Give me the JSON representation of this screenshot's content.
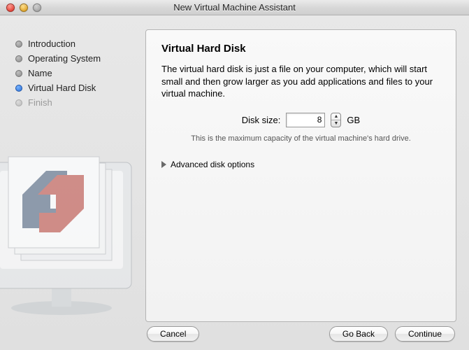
{
  "window": {
    "title": "New Virtual Machine Assistant"
  },
  "sidebar": {
    "steps": [
      {
        "label": "Introduction",
        "state": "done"
      },
      {
        "label": "Operating System",
        "state": "done"
      },
      {
        "label": "Name",
        "state": "done"
      },
      {
        "label": "Virtual Hard Disk",
        "state": "active"
      },
      {
        "label": "Finish",
        "state": "future"
      }
    ]
  },
  "panel": {
    "heading": "Virtual Hard Disk",
    "description": "The virtual hard disk is just a file on your computer, which will start small and then grow larger as you add applications and files to your virtual machine.",
    "disk_size_label": "Disk size:",
    "disk_size_value": "8",
    "disk_size_unit": "GB",
    "hint": "This is the maximum capacity of the virtual machine's hard drive.",
    "advanced_label": "Advanced disk options"
  },
  "footer": {
    "cancel": "Cancel",
    "back": "Go Back",
    "next": "Continue"
  }
}
